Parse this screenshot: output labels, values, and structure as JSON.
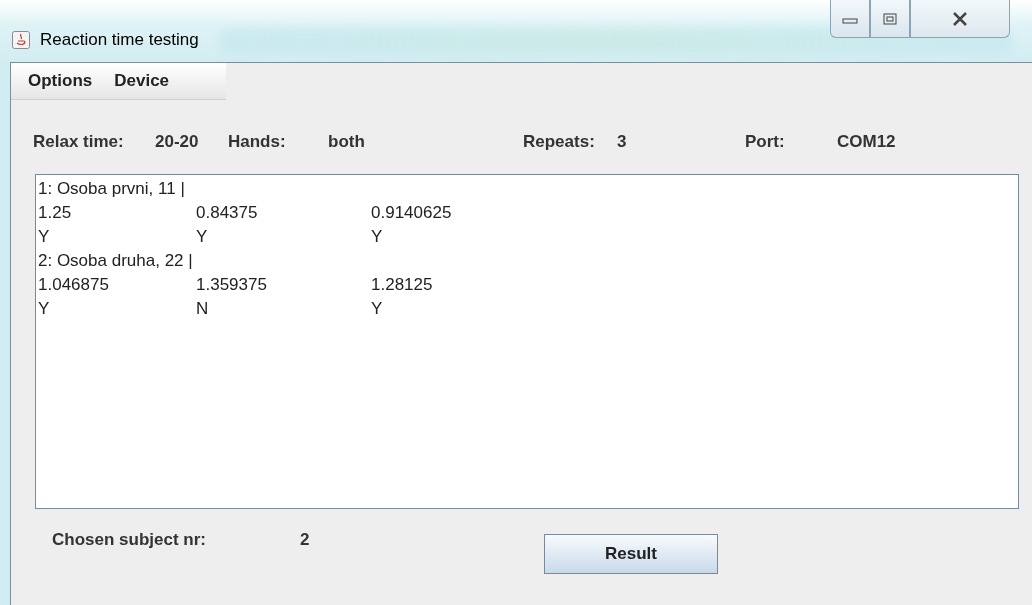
{
  "window": {
    "title": "Reaction time testing"
  },
  "menu": [
    "Options",
    "Device"
  ],
  "settings": [
    "Relax time:",
    "20-20",
    "Hands:",
    "both",
    "Repeats:",
    "3",
    "Port:",
    "COM12"
  ],
  "results": [
    {
      "header": "1: Osoba prvni, 11 |",
      "times": [
        "1.25",
        "0.84375",
        "0.9140625"
      ],
      "flags": [
        "Y",
        "Y",
        "Y"
      ]
    },
    {
      "header": "2: Osoba druha, 22 |",
      "times": [
        "1.046875",
        "1.359375",
        "1.28125"
      ],
      "flags": [
        "Y",
        "N",
        "Y"
      ]
    }
  ],
  "subject": {
    "label": "Chosen subject nr:",
    "value": "2"
  },
  "buttons": [
    "Result"
  ]
}
